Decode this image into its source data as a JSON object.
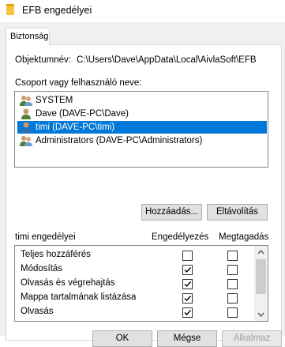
{
  "window": {
    "title": "EFB engedélyei",
    "title_icon": "folder-icon"
  },
  "tabs": [
    {
      "label": "Biztonság"
    }
  ],
  "object": {
    "label": "Objektumnév:",
    "value": "C:\\Users\\Dave\\AppData\\Local\\AivlaSoft\\EFB"
  },
  "group_list": {
    "label": "Csoport vagy felhasználó neve:",
    "items": [
      {
        "label": "SYSTEM",
        "icon": "group-icon",
        "selected": false
      },
      {
        "label": "Dave (DAVE-PC\\Dave)",
        "icon": "user-icon",
        "selected": false
      },
      {
        "label": "timi (DAVE-PC\\timi)",
        "icon": "user-icon",
        "selected": true
      },
      {
        "label": "Administrators (DAVE-PC\\Administrators)",
        "icon": "group-icon",
        "selected": false
      }
    ]
  },
  "buttons": {
    "add": "Hozzáadás...",
    "remove": "Eltávolítás"
  },
  "permissions": {
    "title": "timi engedélyei",
    "allow_header": "Engedélyezés",
    "deny_header": "Megtagadás",
    "rows": [
      {
        "name": "Teljes hozzáférés",
        "allow": false,
        "deny": false
      },
      {
        "name": "Módosítás",
        "allow": true,
        "deny": false
      },
      {
        "name": "Olvasás és végrehajtás",
        "allow": true,
        "deny": false
      },
      {
        "name": "Mappa tartalmának listázása",
        "allow": true,
        "deny": false
      },
      {
        "name": "Olvasás",
        "allow": true,
        "deny": false
      }
    ]
  },
  "footer": {
    "ok": "OK",
    "cancel": "Mégse",
    "apply": "Alkalmaz"
  },
  "colors": {
    "selection": "#0078d7",
    "dialog_bg": "#f0f0f0",
    "folder": "#f5c542"
  }
}
